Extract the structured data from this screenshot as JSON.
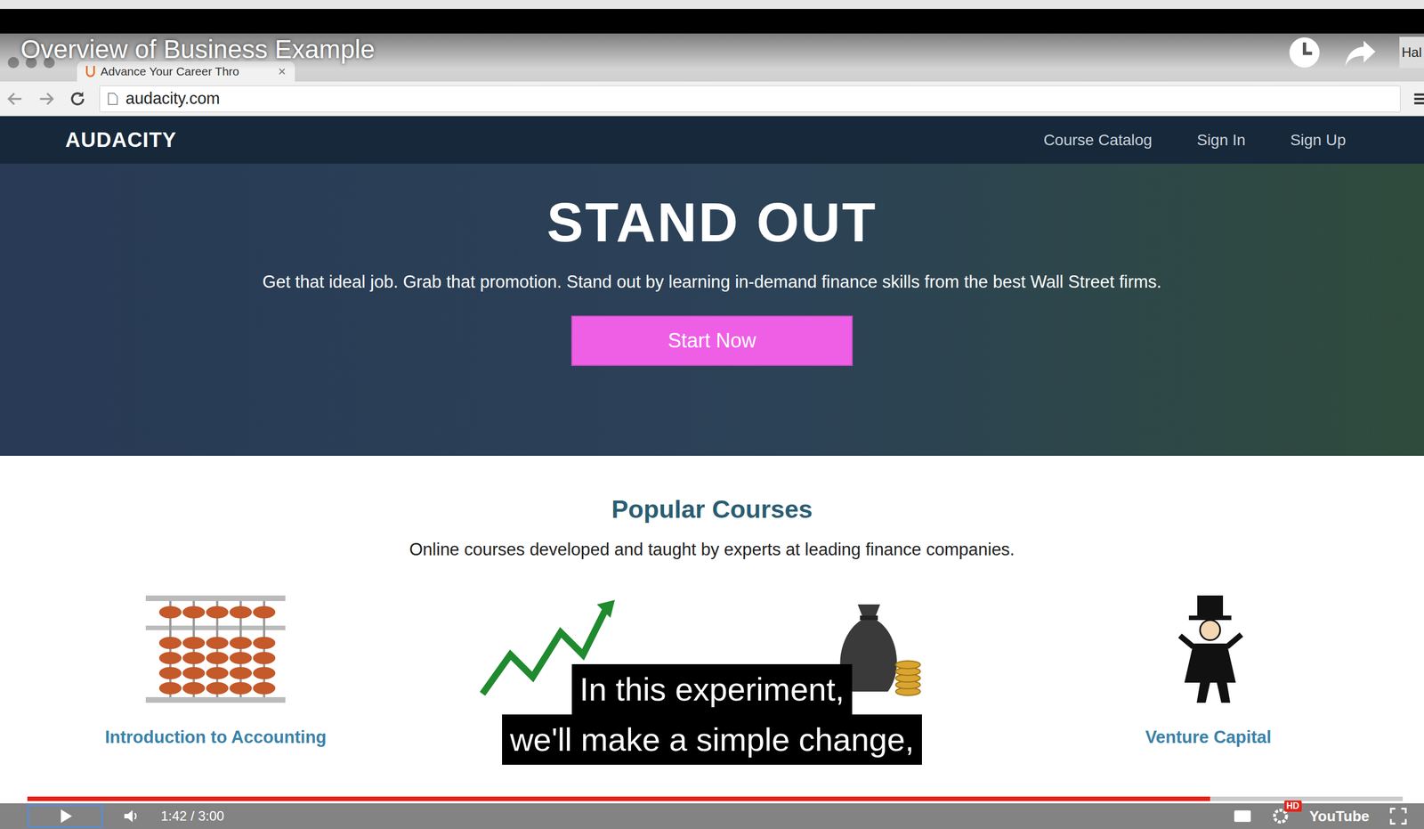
{
  "player": {
    "title": "Overview of Business Example",
    "side_label": "Hal",
    "time": "1:42 / 3:00",
    "progress": 0.86,
    "quality_badge": "HD",
    "logo": "YouTube",
    "captions": [
      "In this experiment,",
      "we'll make a simple change,"
    ]
  },
  "browser": {
    "tab": {
      "label": "Advance Your Career Thro",
      "close": "×"
    },
    "address": "audacity.com"
  },
  "site": {
    "brand": "AUDACITY",
    "nav": [
      "Course Catalog",
      "Sign In",
      "Sign Up"
    ],
    "hero": {
      "title": "STAND OUT",
      "subtitle": "Get that ideal job. Grab that promotion. Stand out by learning in-demand finance skills from the best Wall Street firms.",
      "button": "Start Now"
    },
    "section": {
      "title": "Popular Courses",
      "description": "Online courses developed and taught by experts at leading finance companies."
    },
    "courses": [
      {
        "kind": "abacus",
        "label": "Introduction to Accounting"
      },
      {
        "kind": "profit"
      },
      {
        "kind": "moneybag"
      },
      {
        "kind": "tycoon",
        "label": "Venture Capital"
      }
    ]
  }
}
